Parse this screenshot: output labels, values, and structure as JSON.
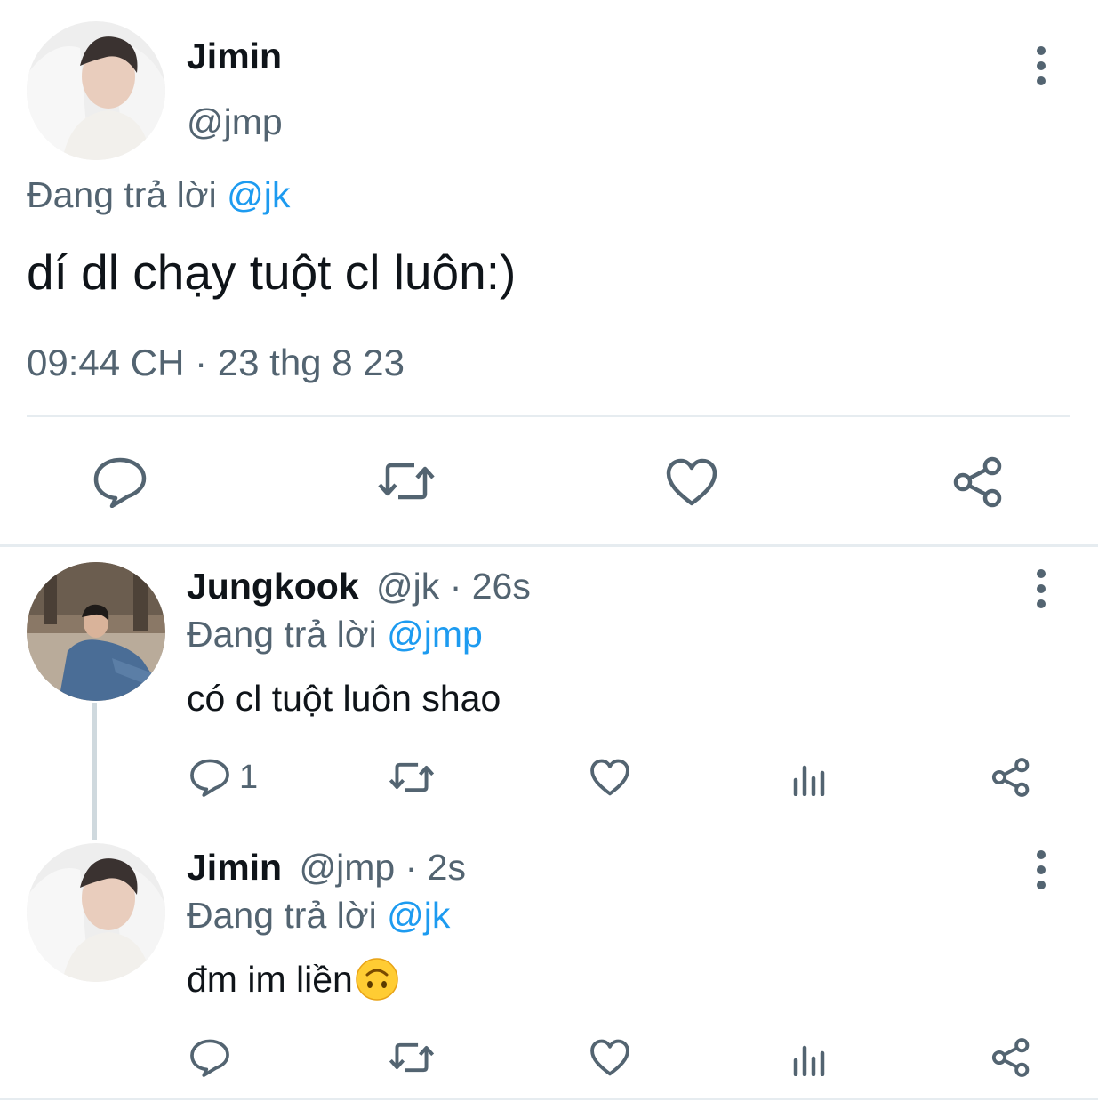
{
  "main_tweet": {
    "display_name": "Jimin",
    "handle": "@jmp",
    "reply_prefix": "Đang trả lời",
    "reply_to": "@jk",
    "text": "dí dl chạy tuột cl luôn:)",
    "timestamp": "09:44 CH · 23 thg 8 23",
    "actions": {
      "reply_icon": "reply-icon",
      "retweet_icon": "retweet-icon",
      "like_icon": "heart-icon",
      "share_icon": "share-icon"
    }
  },
  "replies": [
    {
      "display_name": "Jungkook",
      "handle": "@jk",
      "age": "· 26s",
      "reply_prefix": "Đang trả lời",
      "reply_to": "@jmp",
      "text": "có cl tuột luôn shao",
      "reply_count": "1"
    },
    {
      "display_name": "Jimin",
      "handle": "@jmp",
      "age": "· 2s",
      "reply_prefix": "Đang trả lời",
      "reply_to": "@jk",
      "text": "đm im liền",
      "emoji": "🙃",
      "reply_count": ""
    }
  ],
  "colors": {
    "text": "#0f1419",
    "secondary": "#536471",
    "link": "#1d9bf0",
    "divider": "#e6ecf0"
  }
}
